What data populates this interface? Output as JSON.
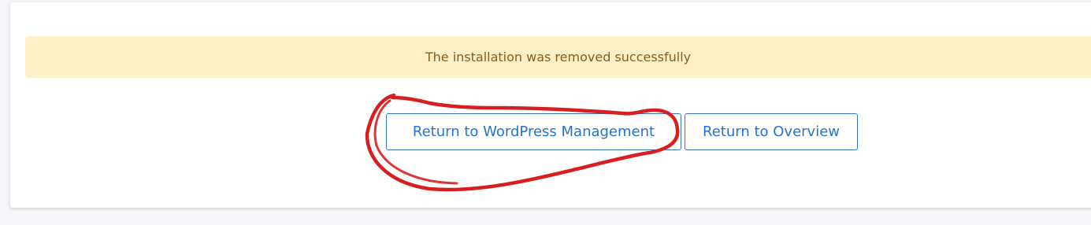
{
  "alert": {
    "message": "The installation was removed successfully",
    "color": "#8a5d17",
    "background": "#fdf0c6"
  },
  "actions": {
    "return_wordpress_label": "Return to WordPress Management",
    "return_overview_label": "Return to Overview",
    "accent_color": "#2473cc"
  },
  "annotation": {
    "type": "hand-drawn circle",
    "color": "#d81f1f",
    "target": "return-to-wordpress-management-button"
  }
}
